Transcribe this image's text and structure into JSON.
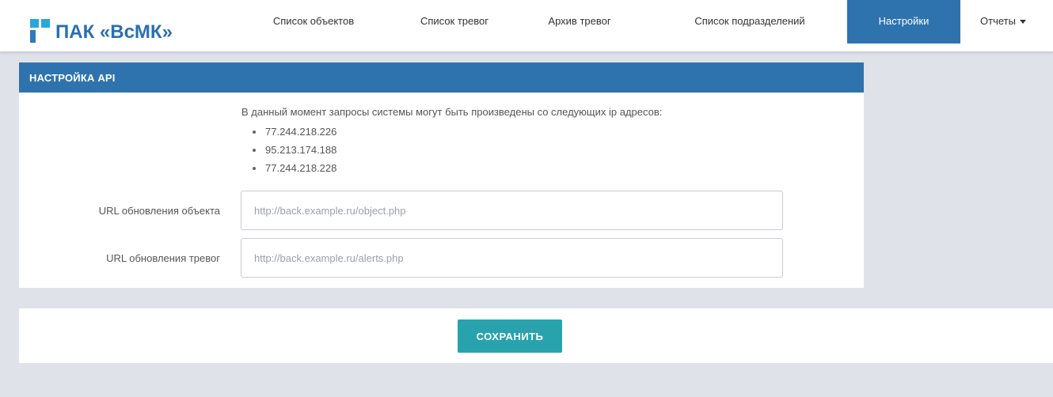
{
  "brand": {
    "logo_text": "ПАК «ВсМК»",
    "primary_color": "#2f73ae",
    "accent_color": "#28a3ad"
  },
  "nav": {
    "items": [
      {
        "label": "Список объектов"
      },
      {
        "label": "Список тревог"
      },
      {
        "label": "Архив тревог"
      },
      {
        "label": "Список подразделений"
      },
      {
        "label": "Настройки",
        "active": true
      },
      {
        "label": "Отчеты",
        "dropdown": true
      }
    ]
  },
  "panel": {
    "title": "НАСТРОЙКА API",
    "ip_intro": "В данный момент запросы системы могут быть произведены со следующих ip адресов:",
    "ip_addresses": [
      "77.244.218.226",
      "95.213.174.188",
      "77.244.218.228"
    ],
    "fields": [
      {
        "label": "URL обновления объекта",
        "placeholder": "http://back.example.ru/object.php",
        "value": ""
      },
      {
        "label": "URL обновления тревог",
        "placeholder": "http://back.example.ru/alerts.php",
        "value": ""
      }
    ]
  },
  "actions": {
    "save_label": "СОХРАНИТЬ"
  }
}
